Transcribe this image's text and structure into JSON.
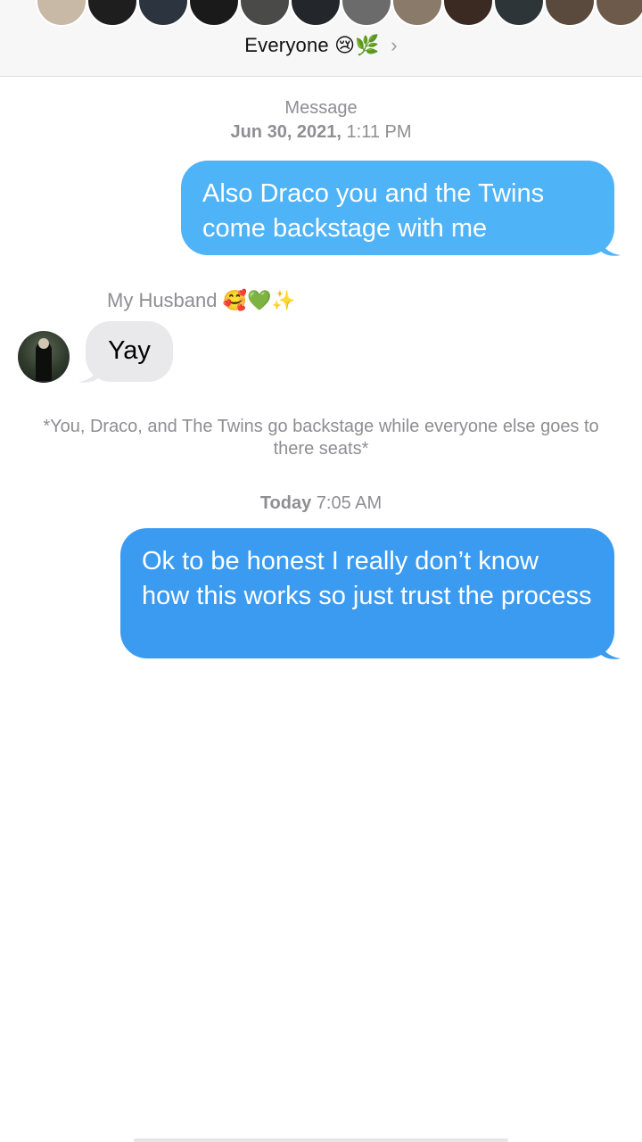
{
  "header": {
    "group_name": "Everyone",
    "group_emoji_1": "😢",
    "group_emoji_2": "🌿",
    "chevron": "›",
    "member_avatar_colors": [
      "#c8b9a6",
      "#1e1e1e",
      "#2c3440",
      "#1a1a1a",
      "#4a4a48",
      "#23262a",
      "#6b6b6b",
      "#8a7a6a",
      "#3b2a22",
      "#2e3538",
      "#5a4a3e",
      "#6d5a4a"
    ]
  },
  "thread": {
    "timestamp_1_label": "Message",
    "timestamp_1_date": "Jun 30, 2021,",
    "timestamp_1_time": "1:11 PM",
    "msg_1": "Also Draco you and the Twins come backstage with me",
    "sender_name": "My Husband",
    "sender_emoji": "🥰💚✨",
    "msg_2": "Yay",
    "narration": "*You, Draco, and The Twins go backstage while everyone else goes to there seats*",
    "timestamp_2_day": "Today",
    "timestamp_2_time": "7:05 AM",
    "msg_3": "Ok to be honest I really don’t know how this works so just trust the process"
  },
  "colors": {
    "outgoing_bubble_1": "#4fb3f8",
    "outgoing_bubble_2": "#3a9bf1",
    "incoming_bubble": "#e9e9eb",
    "meta_text": "#8e8e93"
  },
  "icons": {
    "chevron": "chevron-right-icon"
  }
}
